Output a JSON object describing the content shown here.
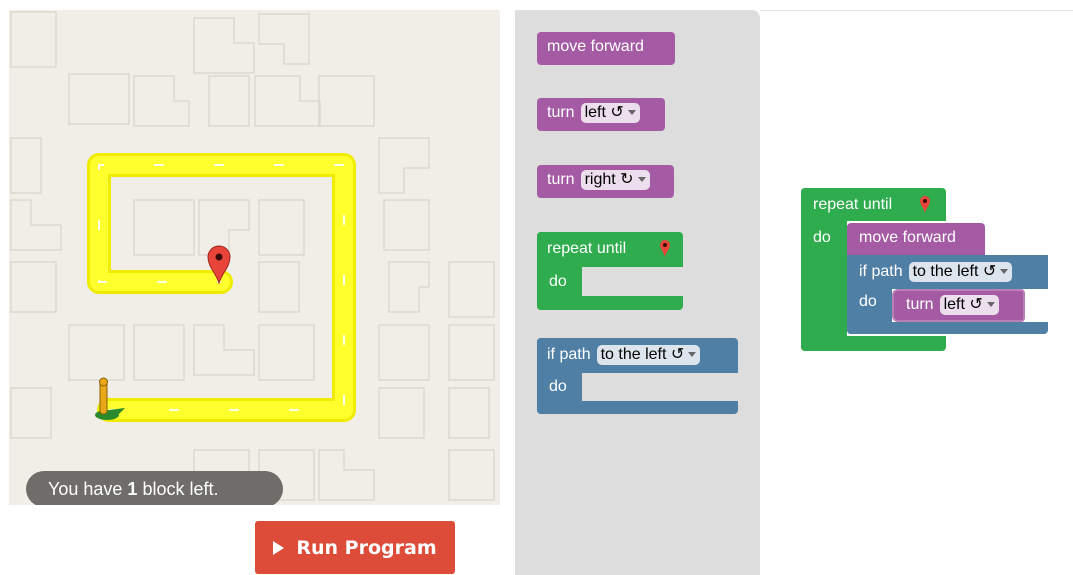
{
  "maze": {
    "message_prefix": "You have ",
    "message_count": "1",
    "message_suffix": " block left.",
    "path_color": "#ffff00",
    "marker_icon": "map-pin-icon",
    "pegman_icon": "pegman-icon"
  },
  "run_button": {
    "label": "Run Program",
    "icon": "play-icon"
  },
  "toolbox": {
    "move_forward": "move forward",
    "turn_left": {
      "label": "turn",
      "dropdown": "left ↺"
    },
    "turn_right": {
      "label": "turn",
      "dropdown": "right ↻"
    },
    "repeat_until": {
      "label": "repeat until",
      "do": "do"
    },
    "if_path": {
      "label": "if path",
      "dropdown": "to the left ↺",
      "do": "do"
    }
  },
  "workspace": {
    "repeat_until": {
      "label": "repeat until",
      "do": "do"
    },
    "move_forward": "move forward",
    "if_path": {
      "label": "if path",
      "dropdown": "to the left ↺",
      "do": "do"
    },
    "turn": {
      "label": "turn",
      "dropdown": "left ↺"
    }
  },
  "colors": {
    "motion_block": "#a55ba4",
    "loop_block": "#2eac4e",
    "logic_block": "#507fa6",
    "run_button": "#dd4b39"
  }
}
